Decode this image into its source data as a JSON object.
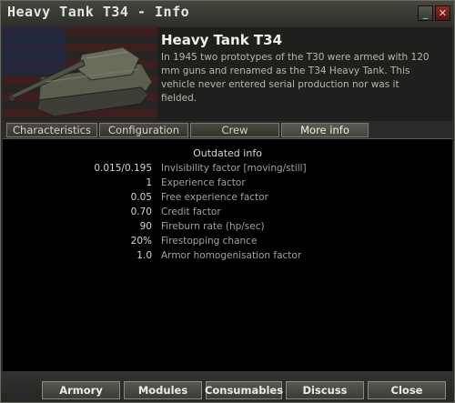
{
  "window": {
    "title": "Heavy Tank T34 - Info",
    "minimize_glyph": "_",
    "close_glyph": "✕"
  },
  "header": {
    "tank_name": "Heavy Tank T34",
    "description": "In 1945 two prototypes of the T30 were armed with 120 mm guns and renamed as the T34 Heavy Tank. This vehicle never entered serial production nor was it fielded.",
    "image_icon": "tank-icon"
  },
  "tabs": [
    {
      "label": "Characteristics"
    },
    {
      "label": "Configuration"
    },
    {
      "label": "Crew"
    },
    {
      "label": "More info",
      "active": true
    }
  ],
  "content": {
    "section_title": "Outdated info",
    "rows": [
      {
        "value": "0.015/0.195",
        "label": "Invisibility factor [moving/still]"
      },
      {
        "value": "1",
        "label": "Experience factor"
      },
      {
        "value": "0.05",
        "label": "Free experience factor"
      },
      {
        "value": "0.70",
        "label": "Credit factor"
      },
      {
        "value": "90",
        "label": "Fireburn rate (hp/sec)"
      },
      {
        "value": "20%",
        "label": "Firestopping chance"
      },
      {
        "value": "1.0",
        "label": "Armor homogenisation factor"
      }
    ]
  },
  "buttons": {
    "armory": "Armory",
    "modules": "Modules",
    "consumables": "Consumables",
    "discuss": "Discuss",
    "close": "Close"
  }
}
